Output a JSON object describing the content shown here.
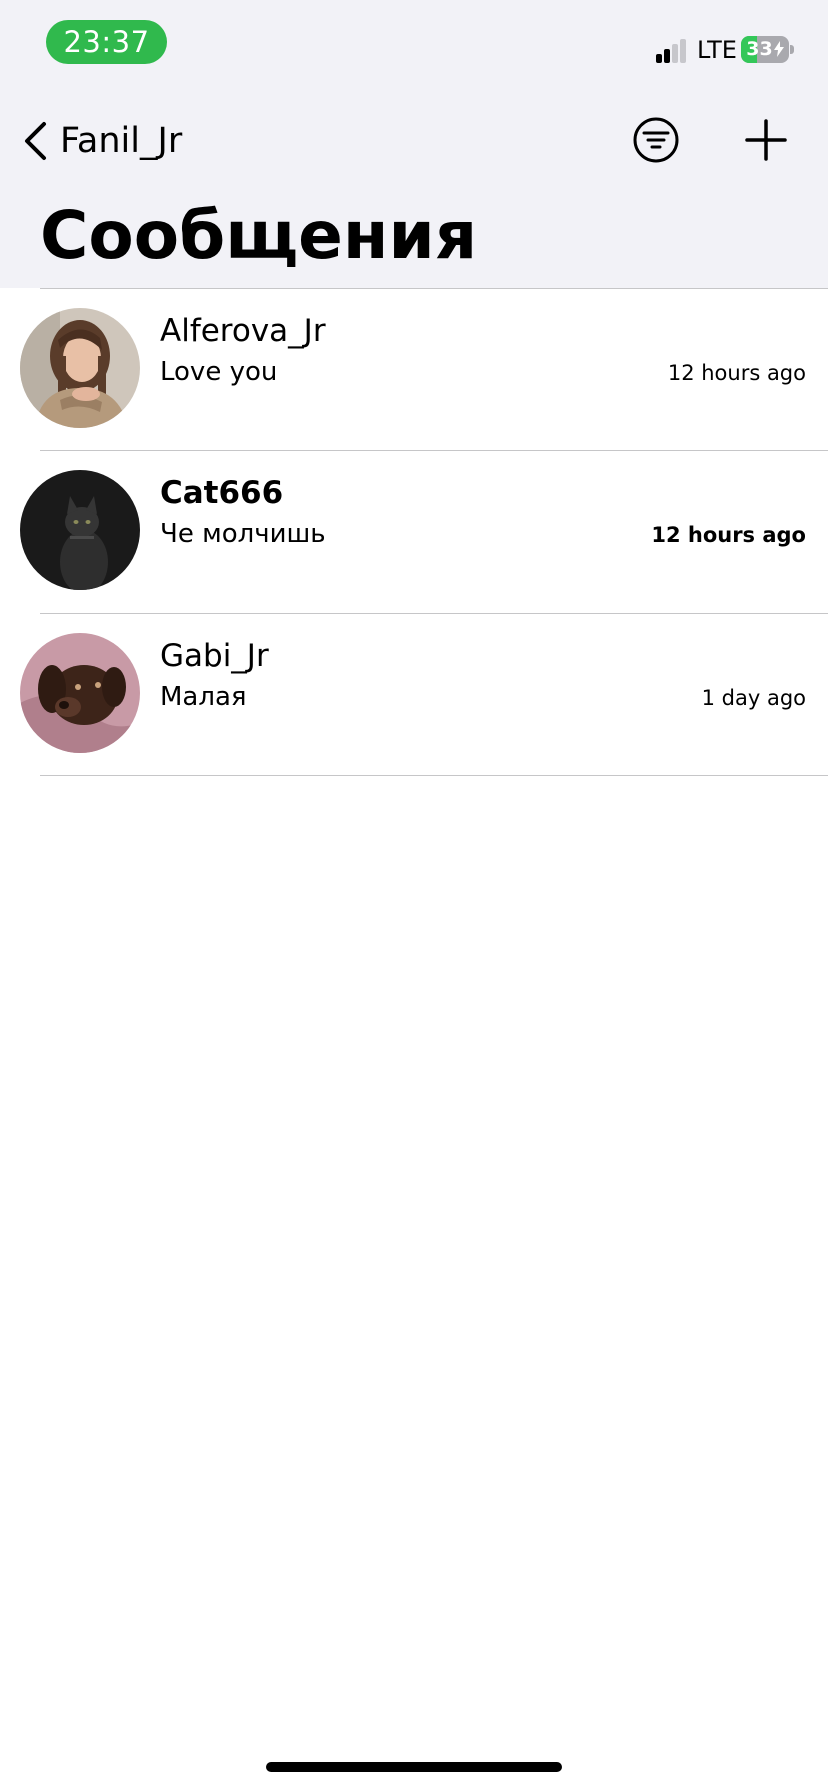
{
  "status_bar": {
    "time": "23:37",
    "network": "LTE",
    "battery_percent": 33,
    "battery_text": "33",
    "signal_bars_filled": 2,
    "icons": [
      "signal-icon",
      "charging-bolt-icon"
    ]
  },
  "nav": {
    "back_label": "Fanil_Jr",
    "back_icon": "chevron-left-icon",
    "filter_icon": "filter-lines-icon",
    "add_icon": "plus-icon"
  },
  "page": {
    "title": "Сообщения"
  },
  "conversations": [
    {
      "name": "Alferova_Jr",
      "last_message": "Love you",
      "time": "12 hours ago",
      "unread": false
    },
    {
      "name": "Cat666",
      "last_message": "Че молчишь",
      "time": "12 hours ago",
      "unread": true
    },
    {
      "name": "Gabi_Jr",
      "last_message": "Малая",
      "time": "1 day ago",
      "unread": false
    }
  ],
  "colors": {
    "time_pill": "#30b94d",
    "battery_fill": "#34c759",
    "header_background": "#f2f2f7",
    "divider": "#c6c6c8"
  }
}
